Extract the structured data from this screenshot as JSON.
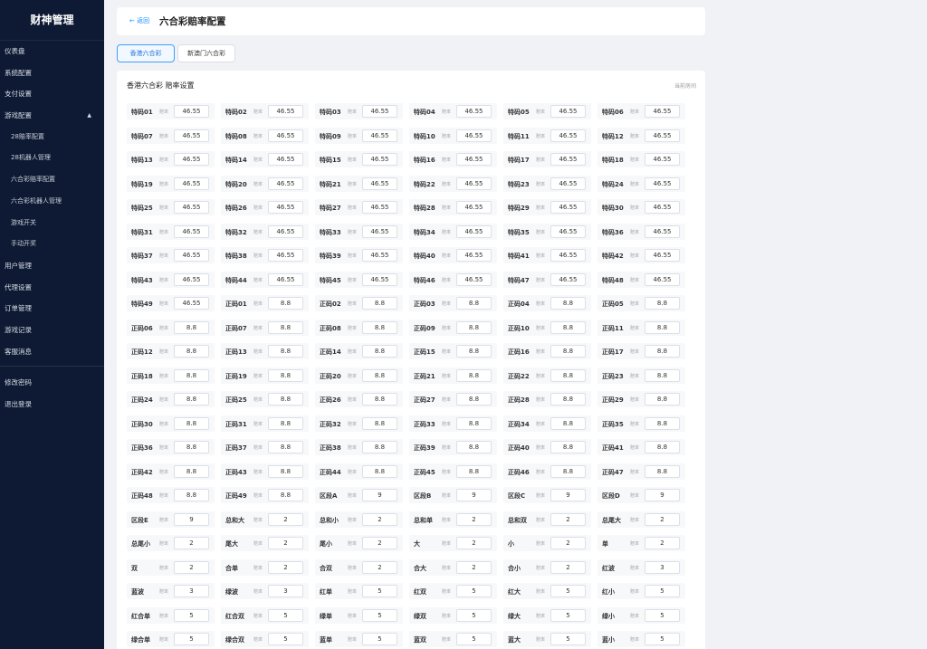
{
  "sidebar": {
    "brand": "财神管理",
    "items": [
      {
        "label": "仪表盘",
        "sub": false
      },
      {
        "label": "系统配置",
        "sub": false
      },
      {
        "label": "支付设置",
        "sub": false
      },
      {
        "label": "游戏配置",
        "sub": false,
        "caret": "▲"
      },
      {
        "label": "28赔率配置",
        "sub": true
      },
      {
        "label": "28机器人管理",
        "sub": true
      },
      {
        "label": "六合彩赔率配置",
        "sub": true
      },
      {
        "label": "六合彩机器人管理",
        "sub": true
      },
      {
        "label": "游戏开关",
        "sub": true
      },
      {
        "label": "手动开奖",
        "sub": true
      },
      {
        "label": "用户管理",
        "sub": false
      },
      {
        "label": "代理设置",
        "sub": false
      },
      {
        "label": "订单管理",
        "sub": false
      },
      {
        "label": "游戏记录",
        "sub": false
      },
      {
        "label": "客服消息",
        "sub": false
      }
    ],
    "bottom_items": [
      {
        "label": "修改密码"
      },
      {
        "label": "退出登录"
      }
    ]
  },
  "header": {
    "back": "← 返回",
    "title": "六合彩赔率配置"
  },
  "tabs": [
    {
      "label": "香港六合彩",
      "active": true
    },
    {
      "label": "新澳门六合彩",
      "active": false
    }
  ],
  "section": {
    "title": "香港六合彩 赔率设置",
    "note": "当前房间"
  },
  "odds_label": "赔率",
  "odds": [
    {
      "name": "特码01",
      "value": "46.55"
    },
    {
      "name": "特码02",
      "value": "46.55"
    },
    {
      "name": "特码03",
      "value": "46.55"
    },
    {
      "name": "特码04",
      "value": "46.55"
    },
    {
      "name": "特码05",
      "value": "46.55"
    },
    {
      "name": "特码06",
      "value": "46.55"
    },
    {
      "name": "特码07",
      "value": "46.55"
    },
    {
      "name": "特码08",
      "value": "46.55"
    },
    {
      "name": "特码09",
      "value": "46.55"
    },
    {
      "name": "特码10",
      "value": "46.55"
    },
    {
      "name": "特码11",
      "value": "46.55"
    },
    {
      "name": "特码12",
      "value": "46.55"
    },
    {
      "name": "特码13",
      "value": "46.55"
    },
    {
      "name": "特码14",
      "value": "46.55"
    },
    {
      "name": "特码15",
      "value": "46.55"
    },
    {
      "name": "特码16",
      "value": "46.55"
    },
    {
      "name": "特码17",
      "value": "46.55"
    },
    {
      "name": "特码18",
      "value": "46.55"
    },
    {
      "name": "特码19",
      "value": "46.55"
    },
    {
      "name": "特码20",
      "value": "46.55"
    },
    {
      "name": "特码21",
      "value": "46.55"
    },
    {
      "name": "特码22",
      "value": "46.55"
    },
    {
      "name": "特码23",
      "value": "46.55"
    },
    {
      "name": "特码24",
      "value": "46.55"
    },
    {
      "name": "特码25",
      "value": "46.55"
    },
    {
      "name": "特码26",
      "value": "46.55"
    },
    {
      "name": "特码27",
      "value": "46.55"
    },
    {
      "name": "特码28",
      "value": "46.55"
    },
    {
      "name": "特码29",
      "value": "46.55"
    },
    {
      "name": "特码30",
      "value": "46.55"
    },
    {
      "name": "特码31",
      "value": "46.55"
    },
    {
      "name": "特码32",
      "value": "46.55"
    },
    {
      "name": "特码33",
      "value": "46.55"
    },
    {
      "name": "特码34",
      "value": "46.55"
    },
    {
      "name": "特码35",
      "value": "46.55"
    },
    {
      "name": "特码36",
      "value": "46.55"
    },
    {
      "name": "特码37",
      "value": "46.55"
    },
    {
      "name": "特码38",
      "value": "46.55"
    },
    {
      "name": "特码39",
      "value": "46.55"
    },
    {
      "name": "特码40",
      "value": "46.55"
    },
    {
      "name": "特码41",
      "value": "46.55"
    },
    {
      "name": "特码42",
      "value": "46.55"
    },
    {
      "name": "特码43",
      "value": "46.55"
    },
    {
      "name": "特码44",
      "value": "46.55"
    },
    {
      "name": "特码45",
      "value": "46.55"
    },
    {
      "name": "特码46",
      "value": "46.55"
    },
    {
      "name": "特码47",
      "value": "46.55"
    },
    {
      "name": "特码48",
      "value": "46.55"
    },
    {
      "name": "特码49",
      "value": "46.55"
    },
    {
      "name": "正码01",
      "value": "8.8"
    },
    {
      "name": "正码02",
      "value": "8.8"
    },
    {
      "name": "正码03",
      "value": "8.8"
    },
    {
      "name": "正码04",
      "value": "8.8"
    },
    {
      "name": "正码05",
      "value": "8.8"
    },
    {
      "name": "正码06",
      "value": "8.8"
    },
    {
      "name": "正码07",
      "value": "8.8"
    },
    {
      "name": "正码08",
      "value": "8.8"
    },
    {
      "name": "正码09",
      "value": "8.8"
    },
    {
      "name": "正码10",
      "value": "8.8"
    },
    {
      "name": "正码11",
      "value": "8.8"
    },
    {
      "name": "正码12",
      "value": "8.8"
    },
    {
      "name": "正码13",
      "value": "8.8"
    },
    {
      "name": "正码14",
      "value": "8.8"
    },
    {
      "name": "正码15",
      "value": "8.8"
    },
    {
      "name": "正码16",
      "value": "8.8"
    },
    {
      "name": "正码17",
      "value": "8.8"
    },
    {
      "name": "正码18",
      "value": "8.8"
    },
    {
      "name": "正码19",
      "value": "8.8"
    },
    {
      "name": "正码20",
      "value": "8.8"
    },
    {
      "name": "正码21",
      "value": "8.8"
    },
    {
      "name": "正码22",
      "value": "8.8"
    },
    {
      "name": "正码23",
      "value": "8.8"
    },
    {
      "name": "正码24",
      "value": "8.8"
    },
    {
      "name": "正码25",
      "value": "8.8"
    },
    {
      "name": "正码26",
      "value": "8.8"
    },
    {
      "name": "正码27",
      "value": "8.8"
    },
    {
      "name": "正码28",
      "value": "8.8"
    },
    {
      "name": "正码29",
      "value": "8.8"
    },
    {
      "name": "正码30",
      "value": "8.8"
    },
    {
      "name": "正码31",
      "value": "8.8"
    },
    {
      "name": "正码32",
      "value": "8.8"
    },
    {
      "name": "正码33",
      "value": "8.8"
    },
    {
      "name": "正码34",
      "value": "8.8"
    },
    {
      "name": "正码35",
      "value": "8.8"
    },
    {
      "name": "正码36",
      "value": "8.8"
    },
    {
      "name": "正码37",
      "value": "8.8"
    },
    {
      "name": "正码38",
      "value": "8.8"
    },
    {
      "name": "正码39",
      "value": "8.8"
    },
    {
      "name": "正码40",
      "value": "8.8"
    },
    {
      "name": "正码41",
      "value": "8.8"
    },
    {
      "name": "正码42",
      "value": "8.8"
    },
    {
      "name": "正码43",
      "value": "8.8"
    },
    {
      "name": "正码44",
      "value": "8.8"
    },
    {
      "name": "正码45",
      "value": "8.8"
    },
    {
      "name": "正码46",
      "value": "8.8"
    },
    {
      "name": "正码47",
      "value": "8.8"
    },
    {
      "name": "正码48",
      "value": "8.8"
    },
    {
      "name": "正码49",
      "value": "8.8"
    },
    {
      "name": "区段A",
      "value": "9"
    },
    {
      "name": "区段B",
      "value": "9"
    },
    {
      "name": "区段C",
      "value": "9"
    },
    {
      "name": "区段D",
      "value": "9"
    },
    {
      "name": "区段E",
      "value": "9"
    },
    {
      "name": "总和大",
      "value": "2"
    },
    {
      "name": "总和小",
      "value": "2"
    },
    {
      "name": "总和单",
      "value": "2"
    },
    {
      "name": "总和双",
      "value": "2"
    },
    {
      "name": "总尾大",
      "value": "2"
    },
    {
      "name": "总尾小",
      "value": "2"
    },
    {
      "name": "尾大",
      "value": "2"
    },
    {
      "name": "尾小",
      "value": "2"
    },
    {
      "name": "大",
      "value": "2"
    },
    {
      "name": "小",
      "value": "2"
    },
    {
      "name": "单",
      "value": "2"
    },
    {
      "name": "双",
      "value": "2"
    },
    {
      "name": "合单",
      "value": "2"
    },
    {
      "name": "合双",
      "value": "2"
    },
    {
      "name": "合大",
      "value": "2"
    },
    {
      "name": "合小",
      "value": "2"
    },
    {
      "name": "红波",
      "value": "3"
    },
    {
      "name": "蓝波",
      "value": "3"
    },
    {
      "name": "绿波",
      "value": "3"
    },
    {
      "name": "红单",
      "value": "5"
    },
    {
      "name": "红双",
      "value": "5"
    },
    {
      "name": "红大",
      "value": "5"
    },
    {
      "name": "红小",
      "value": "5"
    },
    {
      "name": "红合单",
      "value": "5"
    },
    {
      "name": "红合双",
      "value": "5"
    },
    {
      "name": "绿单",
      "value": "5"
    },
    {
      "name": "绿双",
      "value": "5"
    },
    {
      "name": "绿大",
      "value": "5"
    },
    {
      "name": "绿小",
      "value": "5"
    },
    {
      "name": "绿合单",
      "value": "5"
    },
    {
      "name": "绿合双",
      "value": "5"
    },
    {
      "name": "蓝单",
      "value": "5"
    },
    {
      "name": "蓝双",
      "value": "5"
    },
    {
      "name": "蓝大",
      "value": "5"
    },
    {
      "name": "蓝小",
      "value": "5"
    }
  ]
}
